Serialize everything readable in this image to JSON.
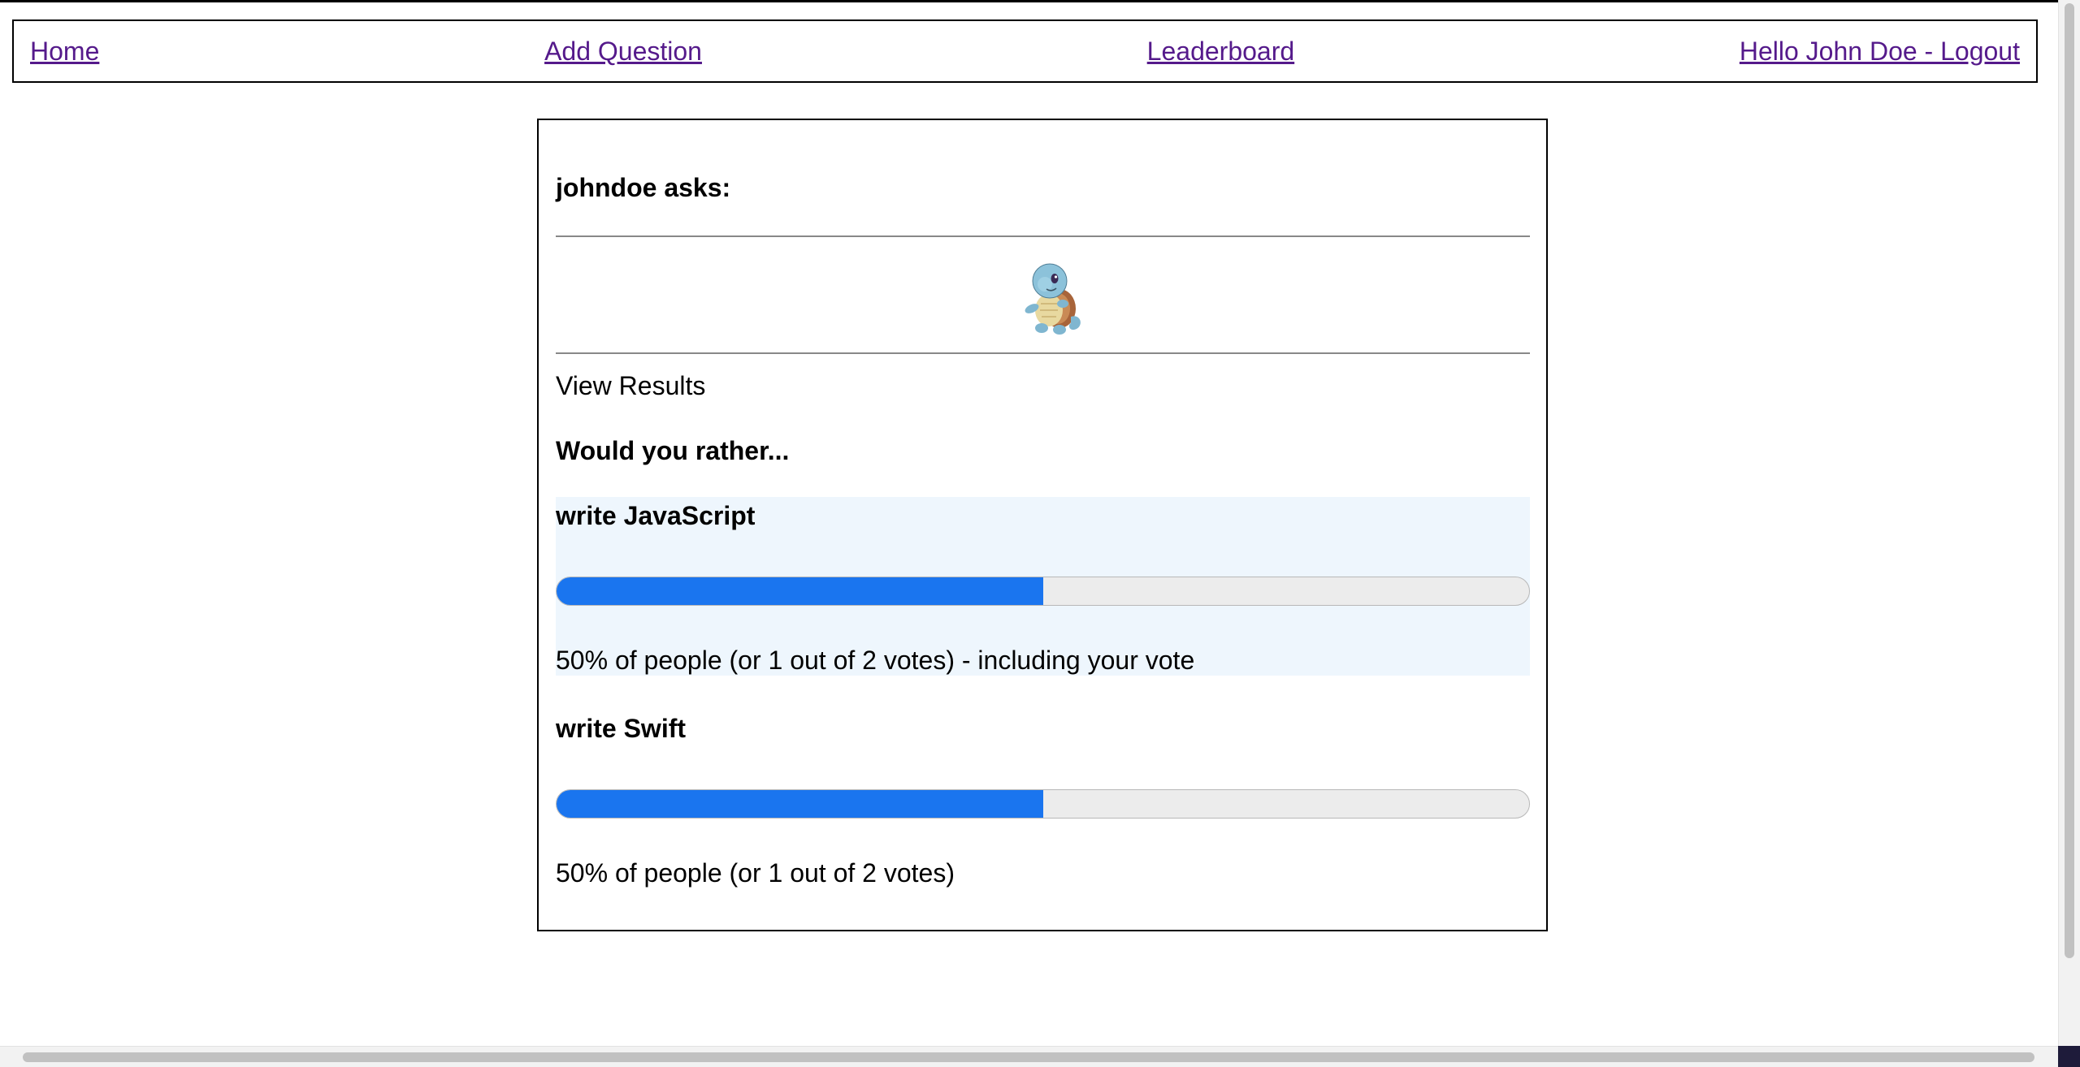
{
  "nav": {
    "home": "Home",
    "add_question": "Add Question",
    "leaderboard": "Leaderboard",
    "user_logout": "Hello John Doe - Logout"
  },
  "question": {
    "asker_text": "johndoe asks:",
    "avatar": "squirtle-avatar",
    "view_results": "View Results",
    "prompt": "Would you rather...",
    "options": [
      {
        "text": "write JavaScript",
        "percent": 50,
        "stats": "50% of people (or 1 out of 2 votes) - including your vote",
        "voted": true
      },
      {
        "text": "write Swift",
        "percent": 50,
        "stats": "50% of people (or 1 out of 2 votes)",
        "voted": false
      }
    ]
  },
  "colors": {
    "link": "#551a8b",
    "bar_fill": "#1a75ef",
    "bar_track": "#ececec",
    "voted_bg": "#eef6fd"
  }
}
